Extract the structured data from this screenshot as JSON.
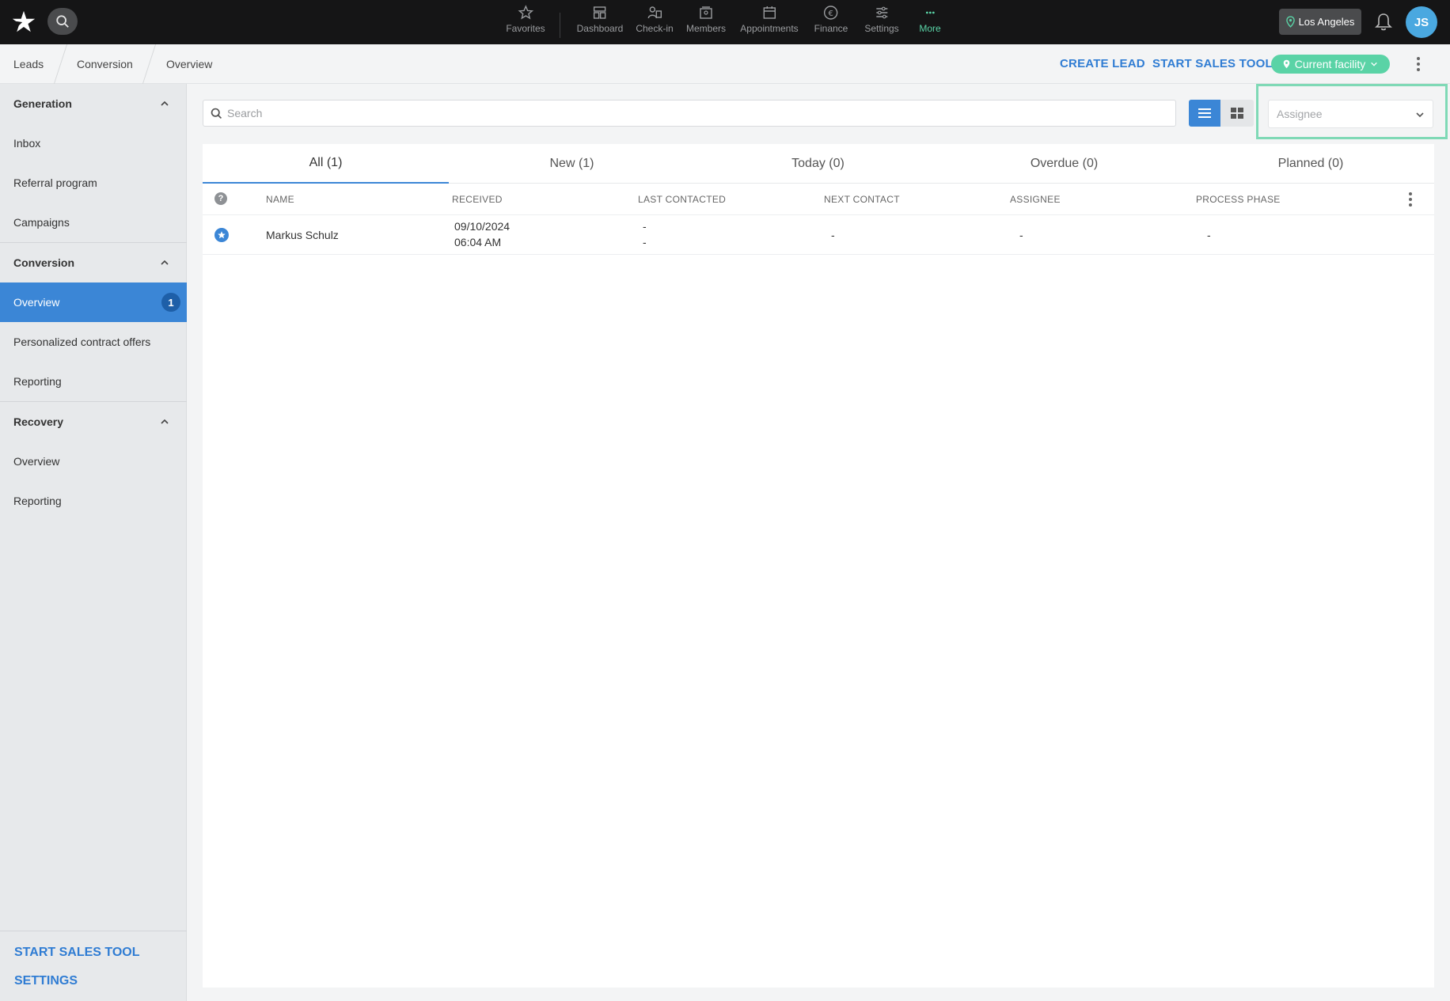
{
  "topbar": {
    "nav": [
      {
        "label": "Favorites",
        "icon": "star-icon"
      },
      {
        "label": "Dashboard",
        "icon": "dashboard-icon"
      },
      {
        "label": "Check-in",
        "icon": "check-in-icon"
      },
      {
        "label": "Members",
        "icon": "members-icon"
      },
      {
        "label": "Appointments",
        "icon": "calendar-icon"
      },
      {
        "label": "Finance",
        "icon": "euro-icon"
      },
      {
        "label": "Settings",
        "icon": "sliders-icon"
      },
      {
        "label": "More",
        "icon": "more-icon"
      }
    ],
    "location": "Los Angeles",
    "avatar_initials": "JS",
    "accent": "#5ad3a6"
  },
  "breadcrumb": [
    "Leads",
    "Conversion",
    "Overview"
  ],
  "actions": {
    "create_lead": "CREATE LEAD",
    "start_sales_tool": "START SALES TOOL",
    "facility": "Current facility"
  },
  "sidebar": {
    "sections": [
      {
        "title": "Generation",
        "items": [
          "Inbox",
          "Referral program",
          "Campaigns"
        ]
      },
      {
        "title": "Conversion",
        "items": [
          "Overview",
          "Personalized contract offers",
          "Reporting"
        ]
      },
      {
        "title": "Recovery",
        "items": [
          "Overview",
          "Reporting"
        ]
      }
    ],
    "active_badge": "1",
    "footer": [
      "START SALES TOOL",
      "SETTINGS"
    ],
    "active_color": "#3b86d6"
  },
  "search": {
    "placeholder": "Search",
    "value": ""
  },
  "assignee": {
    "placeholder": "Assignee"
  },
  "tabs": [
    "All (1)",
    "New (1)",
    "Today (0)",
    "Overdue (0)",
    "Planned (0)"
  ],
  "table": {
    "headers": [
      "NAME",
      "RECEIVED",
      "LAST CONTACTED",
      "NEXT CONTACT",
      "ASSIGNEE",
      "PROCESS PHASE"
    ],
    "rows": [
      {
        "name": "Markus Schulz",
        "received_date": "09/10/2024",
        "received_time": "06:04 AM",
        "last_contacted_1": "-",
        "last_contacted_2": "-",
        "next_contact": "-",
        "assignee": "-",
        "process_phase": "-"
      }
    ]
  }
}
